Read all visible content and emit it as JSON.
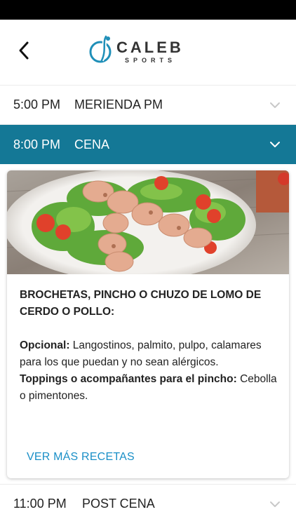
{
  "header": {
    "brand_name": "CALEB",
    "brand_sub": "SPORTS",
    "back_icon": "chevron-left-icon"
  },
  "meals": [
    {
      "time": "5:00 PM",
      "name": "MERIENDA PM",
      "expanded": false
    },
    {
      "time": "8:00 PM",
      "name": "CENA",
      "expanded": true
    },
    {
      "time": "11:00 PM",
      "name": "POST CENA",
      "expanded": false
    }
  ],
  "recipe": {
    "title": "BROCHETAS, PINCHO O CHUZO DE LOMO DE CERDO O POLLO:",
    "optional_label": "Opcional:",
    "optional_text": " Langostinos, palmito, pulpo, calamares para los que puedan y no sean alérgicos.",
    "toppings_label": "Toppings o acompañantes para el pincho:",
    "toppings_text": " Cebolla o pimentones.",
    "more_link": "VER MÁS RECETAS"
  },
  "colors": {
    "accent": "#147896",
    "link": "#1a8fc7",
    "logo_blue": "#1f8fb8"
  }
}
